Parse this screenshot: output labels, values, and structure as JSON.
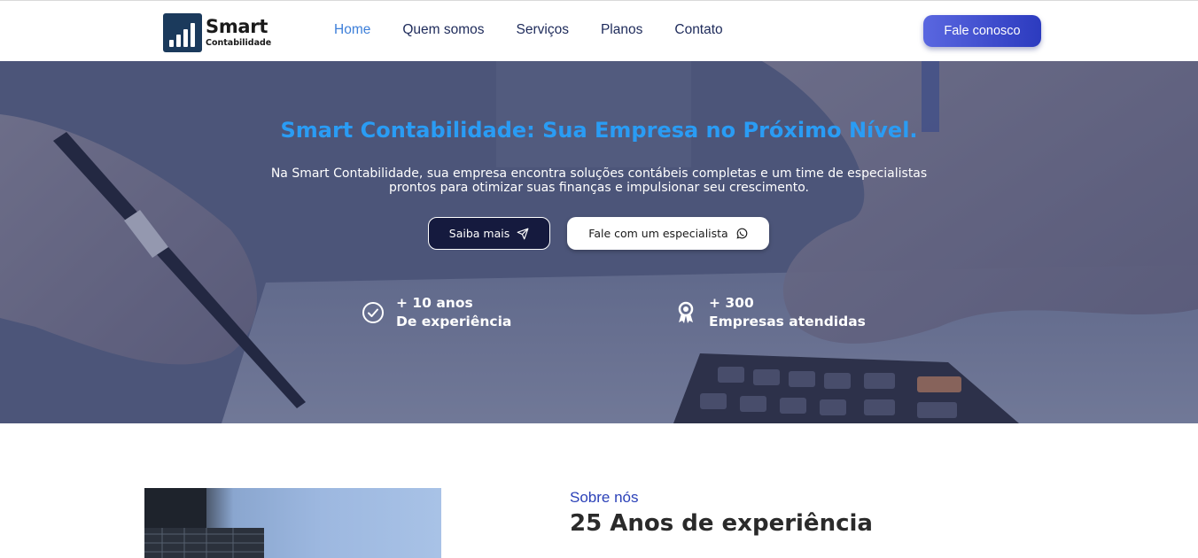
{
  "brand": {
    "title": "Smart",
    "subtitle": "Contabilidade",
    "color": "#1b3a5c"
  },
  "nav": {
    "items": [
      {
        "label": "Home",
        "active": true
      },
      {
        "label": "Quem somos",
        "active": false
      },
      {
        "label": "Serviços",
        "active": false
      },
      {
        "label": "Planos",
        "active": false
      },
      {
        "label": "Contato",
        "active": false
      }
    ],
    "cta_label": "Fale conosco"
  },
  "hero": {
    "title": "Smart Contabilidade: Sua Empresa no Próximo Nível.",
    "description_line1": "Na Smart Contabilidade, sua empresa encontra soluções contábeis completas e um time de especialistas",
    "description_line2": "prontos para otimizar suas finanças e impulsionar seu crescimento.",
    "primary_button": {
      "label": "Saiba mais",
      "icon": "paper-plane-icon"
    },
    "secondary_button": {
      "label": "Fale com um especialista",
      "icon": "whatsapp-icon"
    },
    "stats": [
      {
        "icon": "check-circle-icon",
        "line1": "+ 10 anos",
        "line2": "De experiência"
      },
      {
        "icon": "award-ribbon-icon",
        "line1": "+ 300",
        "line2": "Empresas atendidas"
      }
    ],
    "title_color": "#2a9cf4"
  },
  "about": {
    "eyebrow": "Sobre nós",
    "title": "25 Anos de experiência"
  },
  "colors": {
    "accent": "#3d7fd9",
    "nav_text": "#1d2a5a",
    "button_gradient_start": "#5a67e0",
    "button_gradient_end": "#2c3bbf",
    "dark_button": "#151a3e"
  }
}
